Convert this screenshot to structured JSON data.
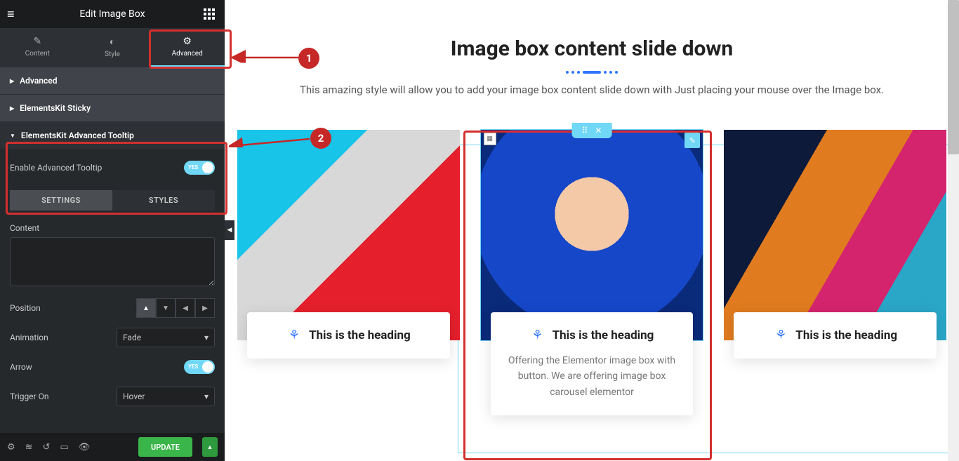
{
  "header": {
    "title": "Edit Image Box"
  },
  "tabs": {
    "content": "Content",
    "style": "Style",
    "advanced": "Advanced"
  },
  "sections": {
    "advanced": "Advanced",
    "sticky": "ElementsKit Sticky",
    "tooltip": "ElementsKit Advanced Tooltip"
  },
  "tooltip": {
    "enable_label": "Enable Advanced Tooltip",
    "toggle_text": "YES",
    "subtab_settings": "SETTINGS",
    "subtab_styles": "STYLES",
    "content_label": "Content",
    "position_label": "Position",
    "animation_label": "Animation",
    "animation_value": "Fade",
    "arrow_label": "Arrow",
    "trigger_label": "Trigger On",
    "trigger_value": "Hover"
  },
  "footer": {
    "update": "UPDATE"
  },
  "callouts": {
    "c1": "1",
    "c2": "2"
  },
  "hero": {
    "title": "Image box content slide down",
    "subtitle": "This amazing style will allow you to add your image box content slide down with Just placing your mouse over the Image box."
  },
  "card": {
    "heading": "This is the heading",
    "body": "Offering the Elementor image box with button. We are offering image box carousel elementor"
  }
}
